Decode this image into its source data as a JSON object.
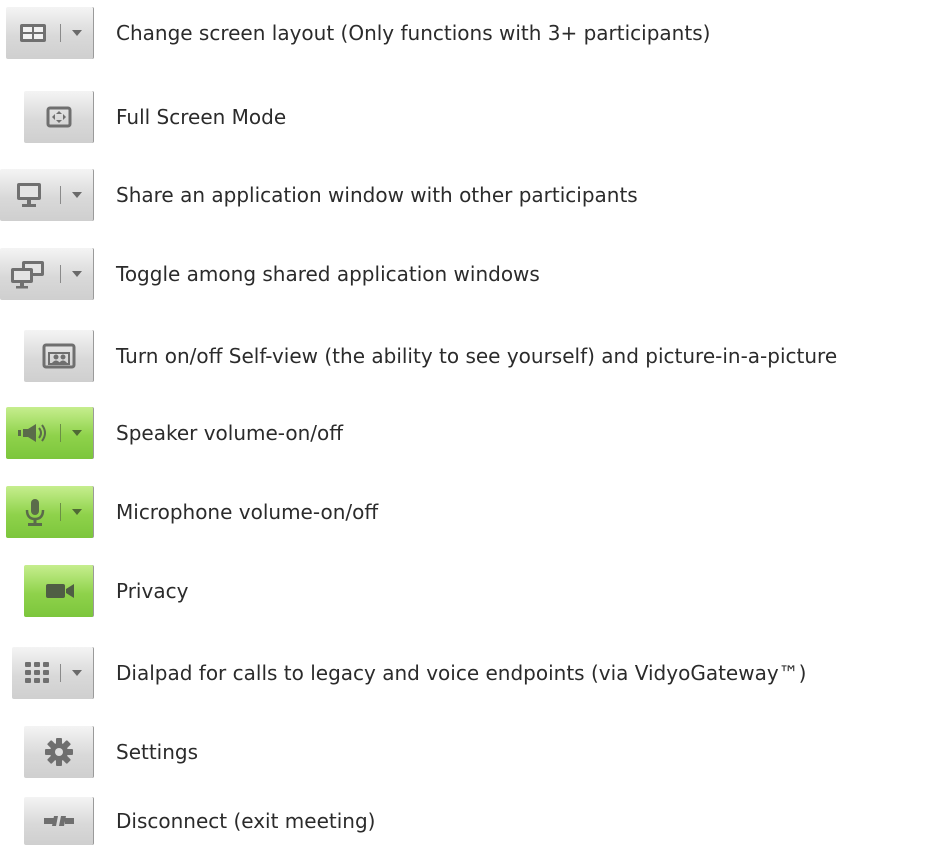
{
  "legend": {
    "items": [
      {
        "icon": "screen-layout-icon",
        "label": "Change screen layout (Only functions with 3+ participants)",
        "style": "gray",
        "dropdown": true
      },
      {
        "icon": "full-screen-icon",
        "label": "Full Screen Mode",
        "style": "gray",
        "dropdown": false
      },
      {
        "icon": "share-window-icon",
        "label": "Share an application window with other participants",
        "style": "gray",
        "dropdown": true
      },
      {
        "icon": "toggle-shared-windows-icon",
        "label": "Toggle among shared application windows",
        "style": "gray",
        "dropdown": true
      },
      {
        "icon": "self-view-icon",
        "label": "Turn on/off Self-view (the ability to see yourself) and picture-in-a-picture",
        "style": "gray",
        "dropdown": false
      },
      {
        "icon": "speaker-icon",
        "label": "Speaker volume-on/off",
        "style": "green",
        "dropdown": true
      },
      {
        "icon": "microphone-icon",
        "label": "Microphone volume-on/off",
        "style": "green",
        "dropdown": true
      },
      {
        "icon": "camera-icon",
        "label": "Privacy",
        "style": "green",
        "dropdown": false
      },
      {
        "icon": "dialpad-icon",
        "label": "Dialpad for calls to legacy and voice endpoints (via VidyoGateway™)",
        "style": "gray",
        "dropdown": true
      },
      {
        "icon": "gear-icon",
        "label": "Settings",
        "style": "gray",
        "dropdown": false
      },
      {
        "icon": "disconnect-icon",
        "label": "Disconnect (exit meeting)",
        "style": "gray",
        "dropdown": false
      }
    ]
  },
  "colors": {
    "accent_green": "#8fd24b",
    "button_gray": "#d9d9d9",
    "icon_gray": "#6f6f6f"
  }
}
